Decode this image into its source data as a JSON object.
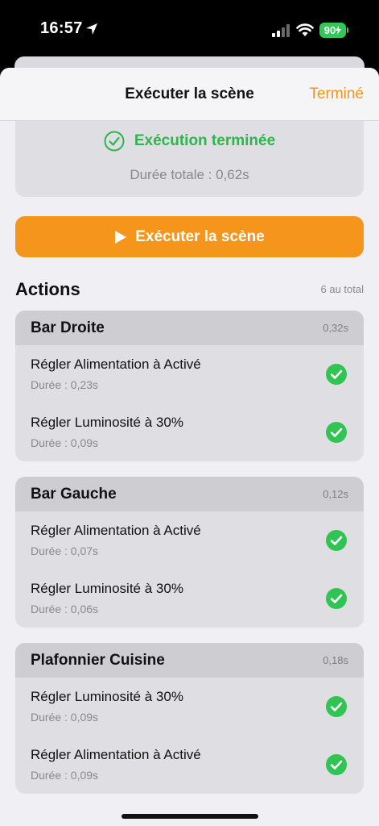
{
  "status_bar": {
    "time": "16:57",
    "battery": "90",
    "icons": [
      "location-arrow-icon",
      "signal-icon",
      "wifi-icon",
      "battery-icon"
    ]
  },
  "nav": {
    "title": "Exécuter la scène",
    "done_label": "Terminé"
  },
  "result": {
    "status": "Exécution terminée",
    "duration": "Durée totale : 0,62s",
    "icon": "check-circle-outline-icon"
  },
  "run_button": {
    "label": "Exécuter la scène",
    "icon": "play-icon"
  },
  "actions": {
    "title": "Actions",
    "count": "6 au total",
    "groups": [
      {
        "name": "Bar Droite",
        "time": "0,32s",
        "items": [
          {
            "label": "Régler Alimentation à Activé",
            "duration": "Durée : 0,23s"
          },
          {
            "label": "Régler Luminosité à 30%",
            "duration": "Durée : 0,09s"
          }
        ]
      },
      {
        "name": "Bar Gauche",
        "time": "0,12s",
        "items": [
          {
            "label": "Régler Alimentation à Activé",
            "duration": "Durée : 0,07s"
          },
          {
            "label": "Régler Luminosité à 30%",
            "duration": "Durée : 0,06s"
          }
        ]
      },
      {
        "name": "Plafonnier Cuisine",
        "time": "0,18s",
        "items": [
          {
            "label": "Régler Luminosité à 30%",
            "duration": "Durée : 0,09s"
          },
          {
            "label": "Régler Alimentation à Activé",
            "duration": "Durée : 0,09s"
          }
        ]
      }
    ]
  },
  "colors": {
    "accent": "#f5951b",
    "success": "#30b44e",
    "background": "#efeff4"
  }
}
